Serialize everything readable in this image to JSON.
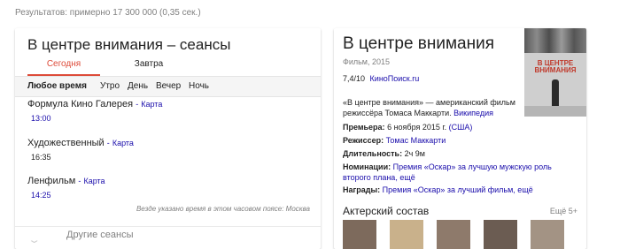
{
  "results_stats": "Результатов: примерно 17 300 000 (0,35 сек.)",
  "showtimes": {
    "title": "В центре внимания – сеансы",
    "tabs": [
      "Сегодня",
      "Завтра"
    ],
    "filters": [
      "Любое время",
      "Утро",
      "День",
      "Вечер",
      "Ночь"
    ],
    "map_label": "Карта",
    "cinemas": [
      {
        "name": "Формула Кино Галерея",
        "time": "13:00",
        "time_link": true
      },
      {
        "name": "Художественный",
        "time": "16:35",
        "time_link": false
      },
      {
        "name": "Ленфильм",
        "time": "14:25",
        "time_link": true
      }
    ],
    "timezone_note": "Везде указано время в этом часовом поясе: Москва",
    "other_sessions": "Другие сеансы"
  },
  "knowledge": {
    "title": "В центре внимания",
    "subtitle": "Фильм, 2015",
    "rating": "7,4/10",
    "rating_source": "КиноПоиск.ru",
    "poster_title": "В ЦЕНТРЕ ВНИМАНИЯ",
    "description": "«В центре внимания» — американский фильм режиссёра Томаса Маккарти.",
    "wikipedia": "Википедия",
    "premiere_label": "Премьера:",
    "premiere_value": "6 ноября 2015 г.",
    "premiere_country": "(США)",
    "director_label": "Режиссер:",
    "director_value": "Томас Маккарти",
    "duration_label": "Длительность:",
    "duration_value": "2ч 9м",
    "nominations_label": "Номинации:",
    "nominations_value": "Премия «Оскар» за лучшую мужскую роль второго плана, ещё",
    "awards_label": "Награды:",
    "awards_value": "Премия «Оскар» за лучший фильм, ещё",
    "cast_title": "Актерский состав",
    "cast_more": "Ещё 5+"
  }
}
